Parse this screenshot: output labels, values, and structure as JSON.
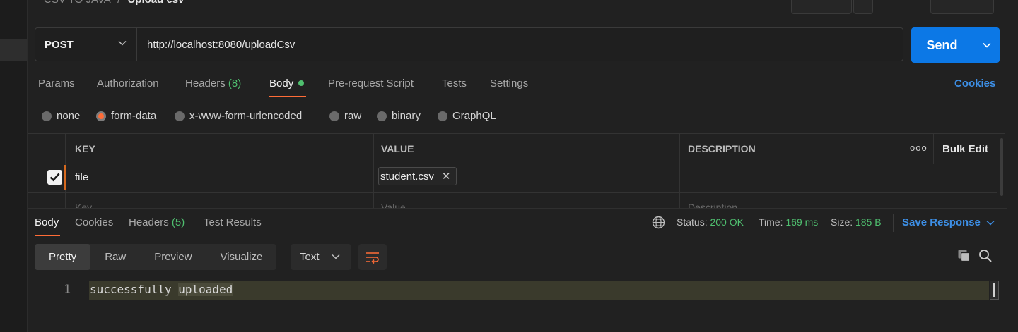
{
  "breadcrumb": {
    "parent": "CSV TO JAVA",
    "separator": "/",
    "current": "Upload csv"
  },
  "request": {
    "method": "POST",
    "url": "http://localhost:8080/uploadCsv",
    "send_label": "Send"
  },
  "request_tabs": [
    {
      "label": "Params"
    },
    {
      "label": "Authorization"
    },
    {
      "label": "Headers",
      "count": "(8)"
    },
    {
      "label": "Body",
      "active": true
    },
    {
      "label": "Pre-request Script"
    },
    {
      "label": "Tests"
    },
    {
      "label": "Settings"
    }
  ],
  "cookies_label": "Cookies",
  "body_types": [
    {
      "label": "none"
    },
    {
      "label": "form-data",
      "selected": true
    },
    {
      "label": "x-www-form-urlencoded"
    },
    {
      "label": "raw"
    },
    {
      "label": "binary"
    },
    {
      "label": "GraphQL"
    }
  ],
  "form_table": {
    "headers": {
      "key": "KEY",
      "value": "VALUE",
      "description": "DESCRIPTION"
    },
    "more_label": "ooo",
    "bulk_edit_label": "Bulk Edit",
    "rows": [
      {
        "checked": true,
        "key": "file",
        "value_file": "student.csv",
        "remove_glyph": "✕"
      }
    ],
    "placeholders": {
      "key": "Key",
      "value": "Value",
      "description": "Description"
    }
  },
  "response_tabs": [
    {
      "label": "Body",
      "active": true
    },
    {
      "label": "Cookies"
    },
    {
      "label": "Headers",
      "count": "(5)"
    },
    {
      "label": "Test Results"
    }
  ],
  "response_meta": {
    "status_label": "Status:",
    "status_value": "200 OK",
    "time_label": "Time:",
    "time_value": "169 ms",
    "size_label": "Size:",
    "size_value": "185 B",
    "save_response_label": "Save Response"
  },
  "view_modes": [
    {
      "label": "Pretty",
      "active": true
    },
    {
      "label": "Raw"
    },
    {
      "label": "Preview"
    },
    {
      "label": "Visualize"
    }
  ],
  "format_select": "Text",
  "response_body": {
    "line_number": "1",
    "text_a": "successfully",
    "text_b": "uploaded"
  },
  "colors": {
    "accent": "#ff6c37",
    "send": "#0c78e6",
    "link": "#3d8fe6",
    "success": "#4fbf6f"
  }
}
